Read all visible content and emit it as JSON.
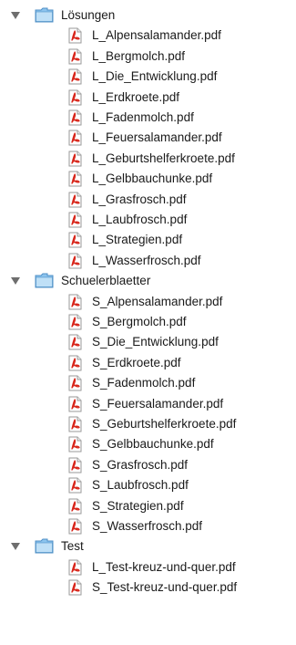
{
  "tree": {
    "folders": [
      {
        "name": "Lösungen",
        "expanded": true,
        "files": [
          "L_Alpensalamander.pdf",
          "L_Bergmolch.pdf",
          "L_Die_Entwicklung.pdf",
          "L_Erdkroete.pdf",
          "L_Fadenmolch.pdf",
          "L_Feuersalamander.pdf",
          "L_Geburtshelferkroete.pdf",
          "L_Gelbbauchunke.pdf",
          "L_Grasfrosch.pdf",
          "L_Laubfrosch.pdf",
          "L_Strategien.pdf",
          "L_Wasserfrosch.pdf"
        ]
      },
      {
        "name": "Schuelerblaetter",
        "expanded": true,
        "files": [
          "S_Alpensalamander.pdf",
          "S_Bergmolch.pdf",
          "S_Die_Entwicklung.pdf",
          "S_Erdkroete.pdf",
          "S_Fadenmolch.pdf",
          "S_Feuersalamander.pdf",
          "S_Geburtshelferkroete.pdf",
          "S_Gelbbauchunke.pdf",
          "S_Grasfrosch.pdf",
          "S_Laubfrosch.pdf",
          "S_Strategien.pdf",
          "S_Wasserfrosch.pdf"
        ]
      },
      {
        "name": "Test",
        "expanded": true,
        "files": [
          "L_Test-kreuz-und-quer.pdf",
          "S_Test-kreuz-und-quer.pdf"
        ]
      }
    ]
  },
  "icons": {
    "disclosure": "disclosure-triangle-down-icon",
    "folder": "folder-icon",
    "file": "pdf-file-icon"
  },
  "colors": {
    "folder_body": "#8cc4ee",
    "folder_edge": "#4f8fc6",
    "pdf_red": "#d8261b",
    "text": "#1a1a1a"
  }
}
